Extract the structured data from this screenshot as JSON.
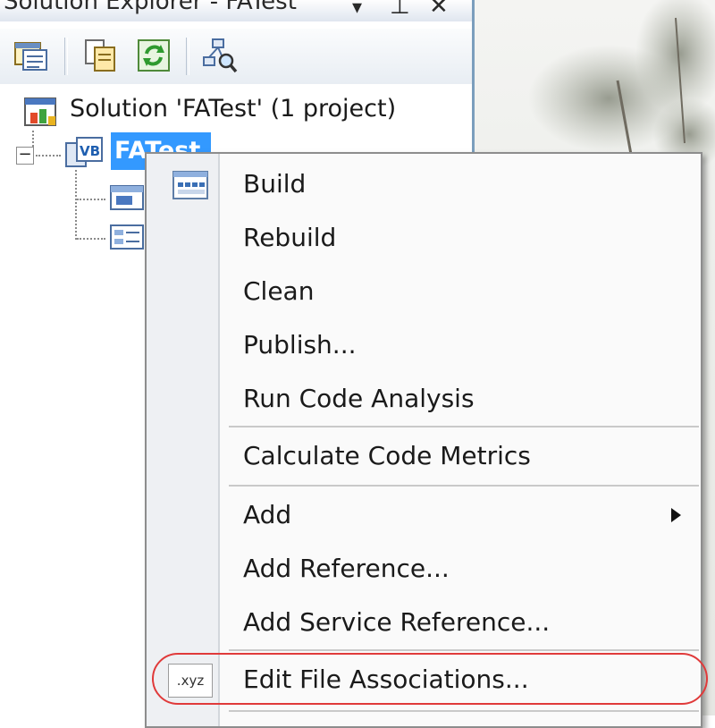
{
  "pane": {
    "title": "Solution Explorer - FATest",
    "title_buttons": {
      "dropdown": "▾",
      "pin": "⊥",
      "close": "✕"
    }
  },
  "tree": {
    "solution_label": "Solution 'FATest' (1 project)",
    "project_label": "FATest",
    "expander_symbol": "−"
  },
  "context_menu": {
    "items": [
      {
        "label": "Build",
        "icon": "build-icon"
      },
      {
        "label": "Rebuild"
      },
      {
        "label": "Clean"
      },
      {
        "label": "Publish..."
      },
      {
        "label": "Run Code Analysis"
      },
      {
        "label": "Calculate Code Metrics"
      },
      {
        "label": "Add",
        "has_submenu": true
      },
      {
        "label": "Add Reference..."
      },
      {
        "label": "Add Service Reference..."
      },
      {
        "label": "Edit File Associations...",
        "icon": "file-extension-icon",
        "icon_text": ".xyz"
      }
    ]
  },
  "colors": {
    "selection": "#3399ff",
    "highlight_oval": "#e03a3a",
    "pane_border": "#7b9ebd"
  }
}
